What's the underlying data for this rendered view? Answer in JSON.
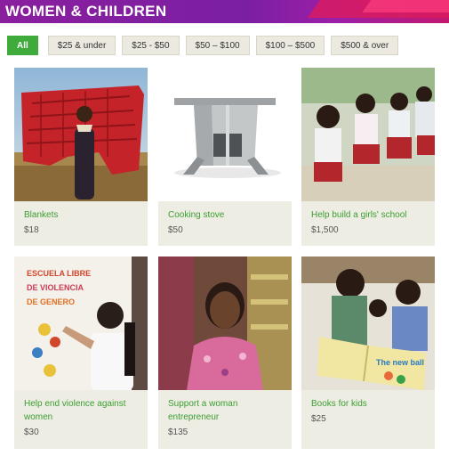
{
  "header": {
    "title": "WOMEN & CHILDREN"
  },
  "filters": [
    "All",
    "$25 & under",
    "$25 - $50",
    "$50 – $100",
    "$100 – $500",
    "$500 & over"
  ],
  "products": [
    {
      "title": "Blankets",
      "price": "$18"
    },
    {
      "title": "Cooking stove",
      "price": "$50"
    },
    {
      "title": "Help build a girls' school",
      "price": "$1,500"
    },
    {
      "title": "Help end violence against women",
      "price": "$30"
    },
    {
      "title": "Support a woman entrepreneur",
      "price": "$135"
    },
    {
      "title": "Books for kids",
      "price": "$25"
    }
  ],
  "mural": {
    "line1": "ESCUELA LIBRE",
    "line2": "DE VIOLENCIA",
    "line3": "DE GENERO"
  },
  "book_title": "The new ball",
  "colors": {
    "accent_green": "#3eab3a",
    "banner_purple": "#8a1f9e",
    "card_bg": "#eeede3"
  }
}
